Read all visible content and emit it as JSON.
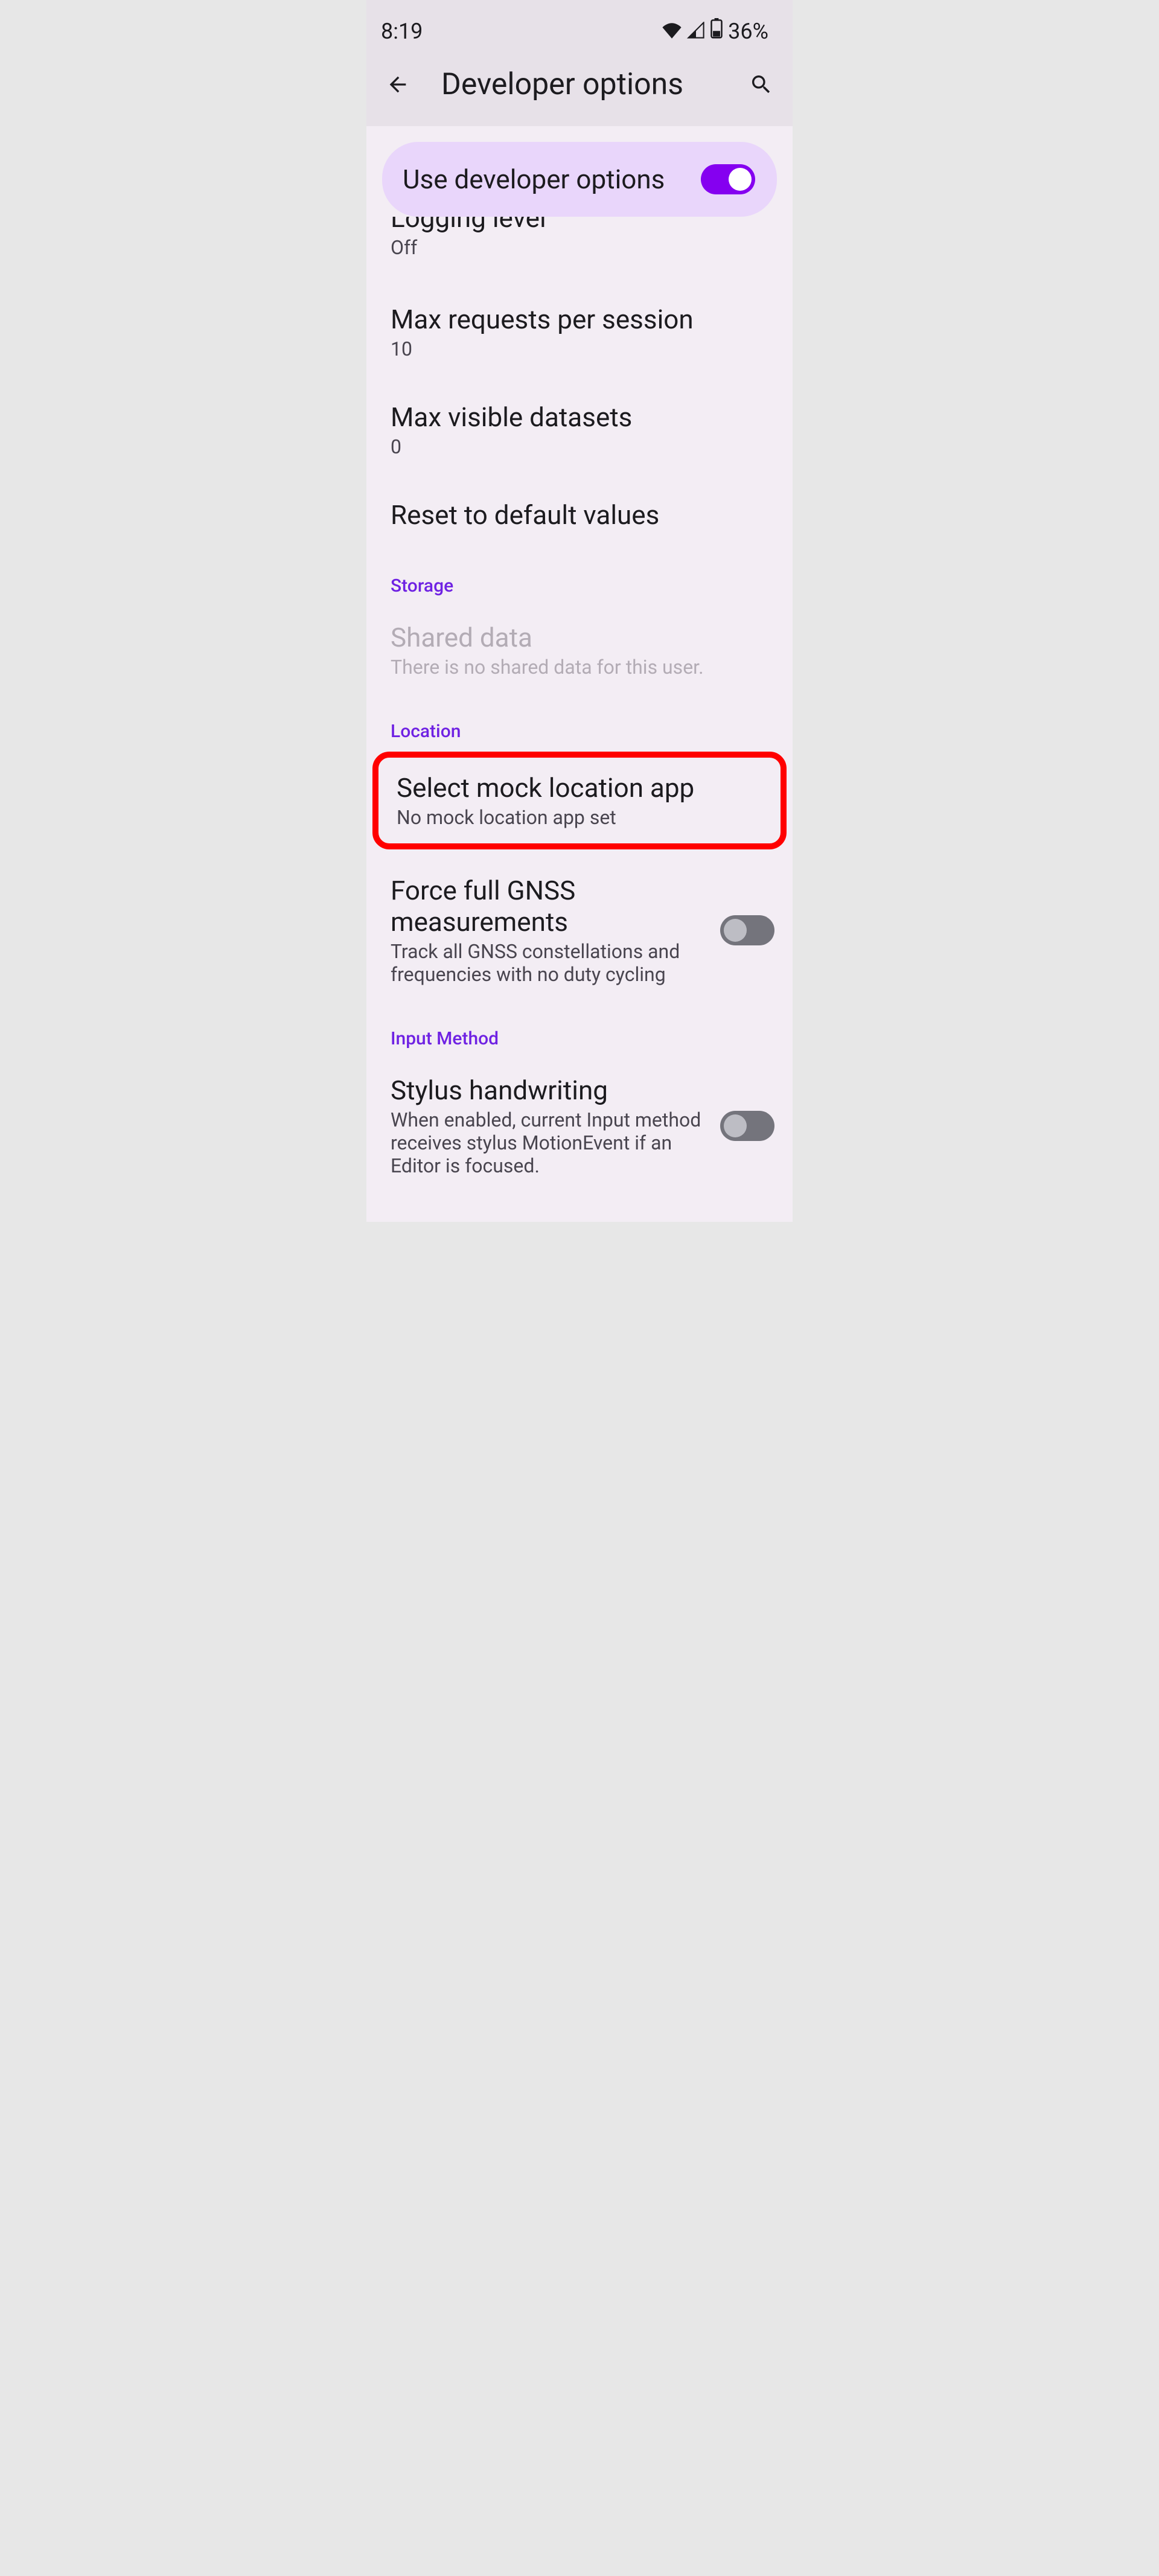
{
  "status": {
    "time": "8:19",
    "battery": "36%"
  },
  "appbar": {
    "title": "Developer options"
  },
  "master": {
    "label": "Use developer options",
    "enabled": true
  },
  "cutoff": {
    "title": "Logging level",
    "sub": "Off"
  },
  "items": [
    {
      "title": "Max requests per session",
      "sub": "10"
    },
    {
      "title": "Max visible datasets",
      "sub": "0"
    },
    {
      "title": "Reset to default values",
      "sub": ""
    }
  ],
  "sections": {
    "storage": {
      "header": "Storage",
      "item": {
        "title": "Shared data",
        "sub": "There is no shared data for this user."
      }
    },
    "location": {
      "header": "Location",
      "mock": {
        "title": "Select mock location app",
        "sub": "No mock location app set"
      },
      "gnss": {
        "title": "Force full GNSS measurements",
        "sub": "Track all GNSS constellations and frequencies with no duty cycling",
        "enabled": false
      }
    },
    "input": {
      "header": "Input Method",
      "stylus": {
        "title": "Stylus handwriting",
        "sub": "When enabled, current Input method receives stylus MotionEvent if an Editor is focused.",
        "enabled": false
      }
    }
  }
}
